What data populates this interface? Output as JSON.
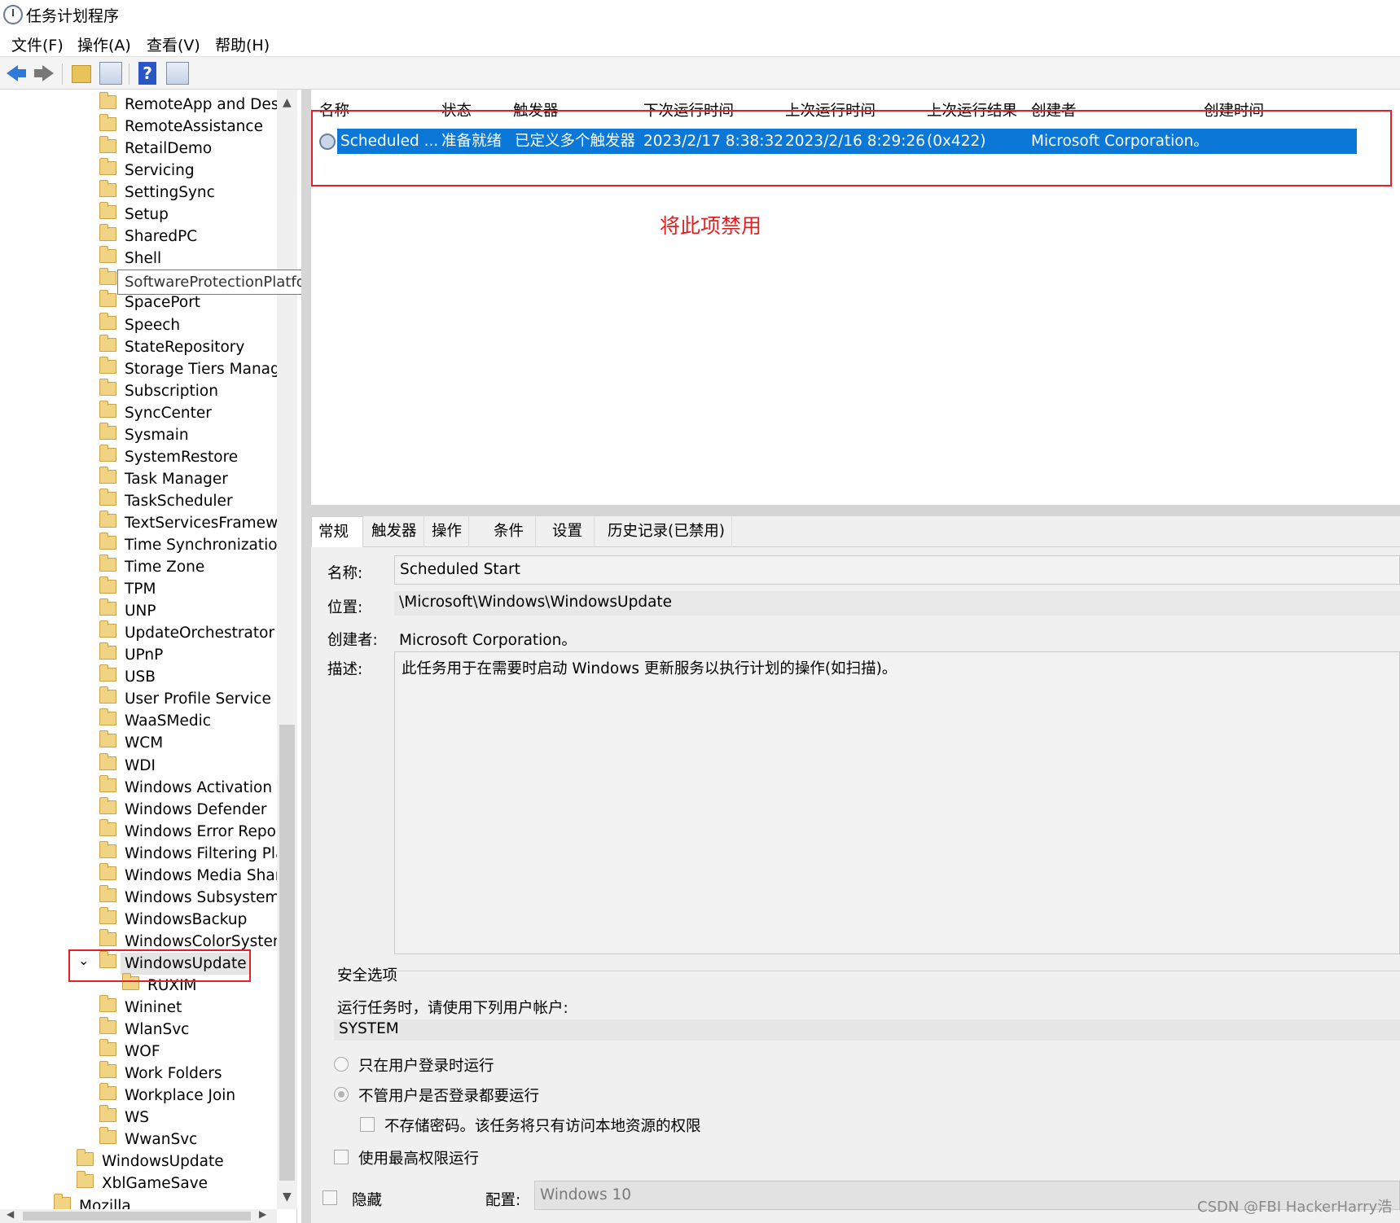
{
  "window": {
    "title": "任务计划程序"
  },
  "menu": [
    "文件(F)",
    "操作(A)",
    "查看(V)",
    "帮助(H)"
  ],
  "toolbar": {
    "help_glyph": "?"
  },
  "tree": {
    "items": [
      "RemoteApp and Deskt",
      "RemoteAssistance",
      "RetailDemo",
      "Servicing",
      "SettingSync",
      "Setup",
      "SharedPC",
      "Shell",
      "SoftwareProtectionPlatform",
      "SpacePort",
      "Speech",
      "StateRepository",
      "Storage Tiers Managen",
      "Subscription",
      "SyncCenter",
      "Sysmain",
      "SystemRestore",
      "Task Manager",
      "TaskScheduler",
      "TextServicesFramewor",
      "Time Synchronization",
      "Time Zone",
      "TPM",
      "UNP",
      "UpdateOrchestrator",
      "UPnP",
      "USB",
      "User Profile Service",
      "WaaSMedic",
      "WCM",
      "WDI",
      "Windows Activation Te",
      "Windows Defender",
      "Windows Error Reportir",
      "Windows Filtering Platf",
      "Windows Media Sharin",
      "Windows Subsystem Fc",
      "WindowsBackup",
      "WindowsColorSystem",
      "WindowsUpdate",
      "RUXIM",
      "Wininet",
      "WlanSvc",
      "WOF",
      "Work Folders",
      "Workplace Join",
      "WS",
      "WwanSvc",
      "WindowsUpdate",
      "XblGameSave",
      "Mozilla"
    ],
    "expand_glyph": "⌄",
    "tooltip": "SoftwareProtectionPlatform"
  },
  "list": {
    "headers": [
      "名称",
      "状态",
      "触发器",
      "下次运行时间",
      "上次运行时间",
      "上次运行结果",
      "创建者",
      "创建时间"
    ],
    "row": [
      "Scheduled ...",
      "准备就绪",
      "已定义多个触发器",
      "2023/2/17 8:38:32",
      "2023/2/16 8:29:26",
      "(0x422)",
      "Microsoft Corporation。",
      ""
    ]
  },
  "annotation": "将此项禁用",
  "tabs": [
    "常规",
    "触发器",
    "操作",
    "条件",
    "设置",
    "历史记录(已禁用)"
  ],
  "general": {
    "name_label": "名称:",
    "name_value": "Scheduled Start",
    "location_label": "位置:",
    "location_value": "\\Microsoft\\Windows\\WindowsUpdate",
    "author_label": "创建者:",
    "author_value": "Microsoft Corporation。",
    "desc_label": "描述:",
    "desc_value": "此任务用于在需要时启动 Windows 更新服务以执行计划的操作(如扫描)。"
  },
  "security": {
    "title": "安全选项",
    "run_as_label": "运行任务时，请使用下列用户帐户:",
    "account": "SYSTEM",
    "radio_logged_on": "只在用户登录时运行",
    "radio_always": "不管用户是否登录都要运行",
    "chk_no_password": "不存储密码。该任务将只有访问本地资源的权限",
    "chk_highest": "使用最高权限运行",
    "chk_hidden": "隐藏",
    "config_label": "配置:",
    "config_value": "Windows 10"
  },
  "watermark": "CSDN @FBI HackerHarry浩"
}
